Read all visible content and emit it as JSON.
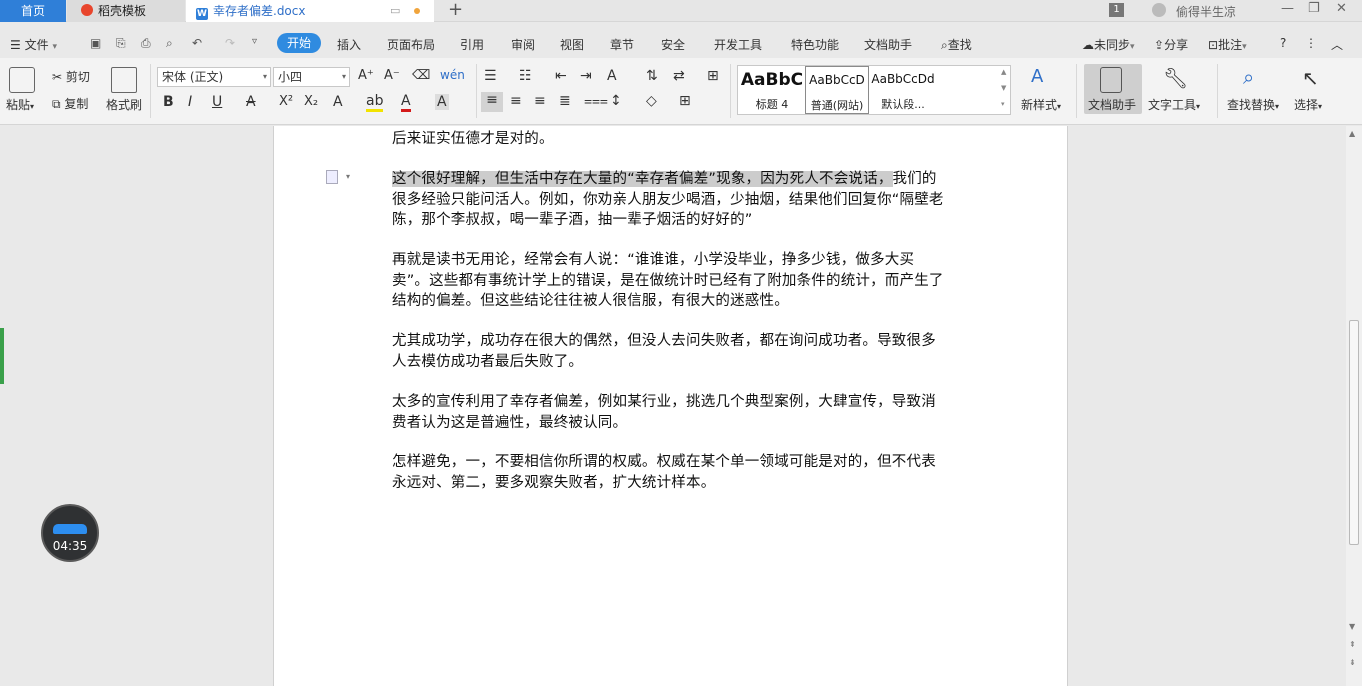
{
  "tabs": {
    "home": "首页",
    "template": "稻壳模板",
    "document": "幸存者偏差.docx",
    "badge": "1",
    "user": "偷得半生凉"
  },
  "menu": {
    "file": "文件",
    "start": "开始",
    "items": [
      "插入",
      "页面布局",
      "引用",
      "审阅",
      "视图",
      "章节",
      "安全",
      "开发工具",
      "特色功能",
      "文档助手"
    ],
    "search": "查找",
    "right": {
      "sync": "未同步",
      "share": "分享",
      "comment": "批注"
    }
  },
  "ribbon": {
    "paste": "粘贴",
    "cut": "剪切",
    "copy": "复制",
    "format_painter": "格式刷",
    "font_name": "宋体 (正文)",
    "font_size": "小四",
    "styles": [
      {
        "sample": "AaBbC",
        "name": "标题 4"
      },
      {
        "sample": "AaBbCcD",
        "name": "普通(网站)"
      },
      {
        "sample": "AaBbCcDd",
        "name": "默认段..."
      }
    ],
    "new_style": "新样式",
    "doc_assistant": "文档助手",
    "text_tools": "文字工具",
    "find_replace": "查找替换",
    "select": "选择"
  },
  "document": {
    "paragraphs": [
      "后来证实伍德才是对的。",
      "这个很好理解，但生活中存在大量的“幸存者偏差”现象，因为死人不会说话，我们的很多经验只能问活人。例如，你劝亲人朋友少喝酒，少抽烟，结果他们回复你“隔壁老陈，那个李叔叔，喝一辈子酒，抽一辈子烟活的好好的”",
      " 再就是读书无用论，经常会有人说：“谁谁谁，小学没毕业，挣多少钱，做多大买卖”。这些都有事统计学上的错误，是在做统计时已经有了附加条件的统计，而产生了结构的偏差。但这些结论往往被人很信服，有很大的迷惑性。",
      "  尤其成功学，成功存在很大的偶然，但没人去问失败者，都在询问成功者。导致很多人去模仿成功者最后失败了。",
      "  太多的宣传利用了幸存者偏差，例如某行业，挑选几个典型案例，大肆宣传，导致消费者认为这是普遍性，最终被认同。",
      " 怎样避免，一，不要相信你所谓的权威。权威在某个单一领域可能是对的，但不代表永远对、第二，要多观察失败者，扩大统计样本。"
    ]
  },
  "timer": "04:35"
}
